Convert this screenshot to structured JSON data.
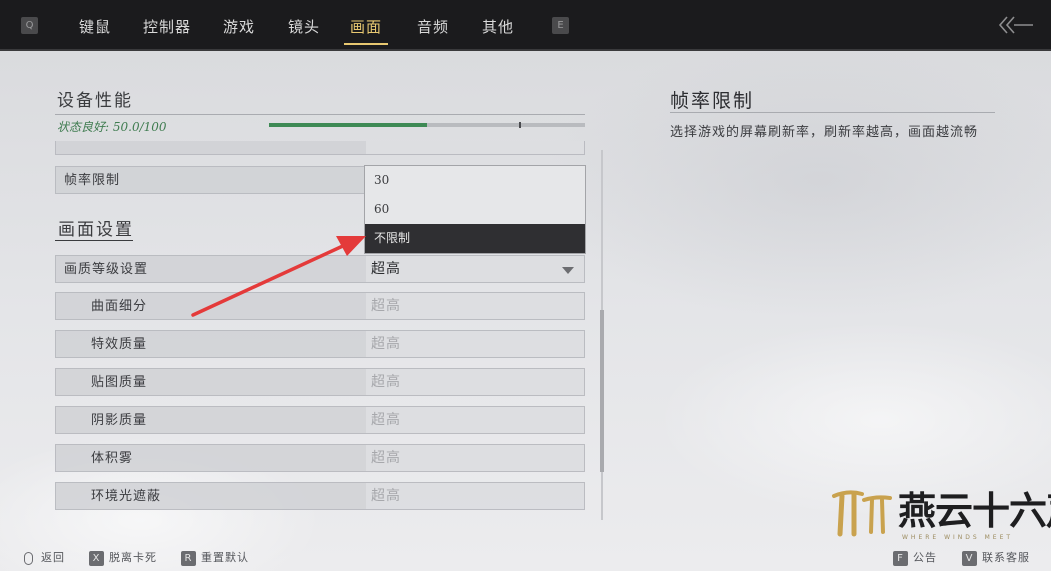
{
  "topbar": {
    "left_key": "Q",
    "right_key": "E",
    "tabs": [
      {
        "label": "键鼠"
      },
      {
        "label": "控制器"
      },
      {
        "label": "游戏"
      },
      {
        "label": "镜头"
      },
      {
        "label": "画面",
        "active": true
      },
      {
        "label": "音频"
      },
      {
        "label": "其他"
      }
    ],
    "back_icon": "double-chevron-left-arrow",
    "accent_color": "#e8c871"
  },
  "performance": {
    "title": "设备性能",
    "status": "状态良好: 50.0/100",
    "score": 50.0,
    "max": 100,
    "status_color": "#3f7c50"
  },
  "frame_rate_row": {
    "label": "帧率限制"
  },
  "dropdown": {
    "options": [
      "30",
      "60",
      "不限制"
    ],
    "selected_index": 2
  },
  "graphics": {
    "title": "画面设置",
    "quality_row": {
      "label": "画质等级设置",
      "value": "超高"
    },
    "sub_rows": [
      {
        "label": "曲面细分",
        "value": "超高"
      },
      {
        "label": "特效质量",
        "value": "超高"
      },
      {
        "label": "贴图质量",
        "value": "超高"
      },
      {
        "label": "阴影质量",
        "value": "超高"
      },
      {
        "label": "体积雾",
        "value": "超高"
      },
      {
        "label": "环境光遮蔽",
        "value": "超高"
      }
    ]
  },
  "help": {
    "title": "帧率限制",
    "description": "选择游戏的屏幕刷新率，刷新率越高，画面越流畅"
  },
  "bottom_hints": {
    "back": {
      "label": "返回"
    },
    "unstuck": {
      "key": "X",
      "label": "脱离卡死"
    },
    "reset": {
      "key": "R",
      "label": "重置默认"
    },
    "notice": {
      "key": "F",
      "label": "公告"
    },
    "support": {
      "key": "V",
      "label": "联系客服"
    }
  },
  "logo": {
    "text": "燕云十六声",
    "subtext": "WHERE WINDS MEET"
  }
}
